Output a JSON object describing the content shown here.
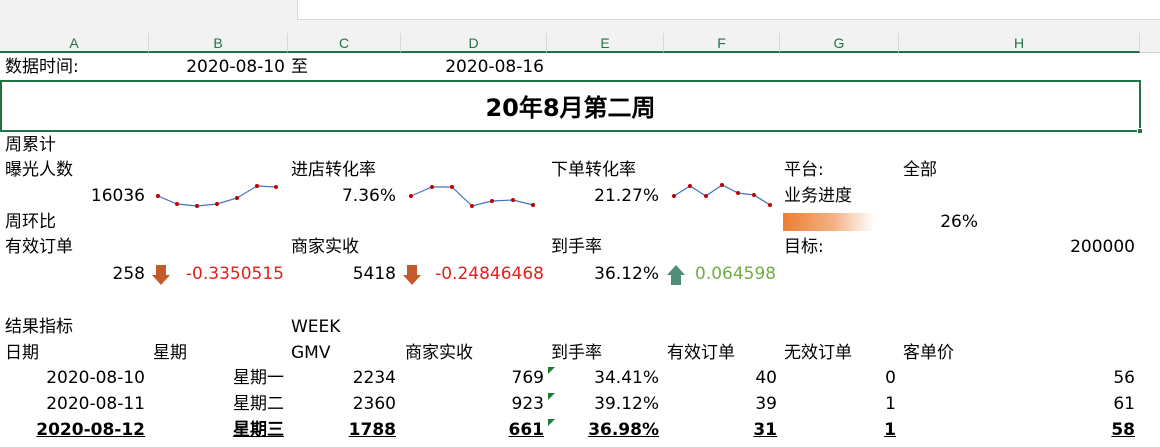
{
  "columns": [
    "A",
    "B",
    "C",
    "D",
    "E",
    "F",
    "G",
    "H"
  ],
  "header": {
    "data_time_label": "数据时间:",
    "start_date": "2020-08-10",
    "to_label": "至",
    "end_date": "2020-08-16",
    "title": "20年8月第二周"
  },
  "weekly": {
    "section_label": "周累计",
    "exposure_label": "曝光人数",
    "exposure_value": "16036",
    "store_conv_label": "进店转化率",
    "store_conv_value": "7.36%",
    "order_conv_label": "下单转化率",
    "order_conv_value": "21.27%"
  },
  "platform": {
    "label": "平台:",
    "value": "全部",
    "progress_label": "业务进度",
    "progress_value": "26%",
    "progress_fraction": 0.26,
    "target_label": "目标:",
    "target_value": "200000"
  },
  "wow": {
    "section_label": "周环比",
    "valid_orders_label": "有效订单",
    "valid_orders_value": "258",
    "valid_orders_change": "-0.3350515",
    "merchant_label": "商家实收",
    "merchant_value": "5418",
    "merchant_change": "-0.24846468",
    "arrival_label": "到手率",
    "arrival_value": "36.12%",
    "arrival_change": "0.064598"
  },
  "icons": {
    "down_arrow_color": "#c55a2b",
    "up_arrow_color": "#4e8f77"
  },
  "results": {
    "section_label": "结果指标",
    "week_label": "WEEK",
    "headers": {
      "date": "日期",
      "weekday": "星期",
      "gmv": "GMV",
      "merchant": "商家实收",
      "arrival": "到手率",
      "valid": "有效订单",
      "invalid": "无效订单",
      "avg": "客单价"
    },
    "rows": [
      {
        "date": "2020-08-10",
        "weekday": "星期一",
        "gmv": "2234",
        "merchant": "769",
        "arrival": "34.41%",
        "valid": "40",
        "invalid": "0",
        "avg": "56"
      },
      {
        "date": "2020-08-11",
        "weekday": "星期二",
        "gmv": "2360",
        "merchant": "923",
        "arrival": "39.12%",
        "valid": "39",
        "invalid": "1",
        "avg": "61"
      },
      {
        "date": "2020-08-12",
        "weekday": "星期三",
        "gmv": "1788",
        "merchant": "661",
        "arrival": "36.98%",
        "valid": "31",
        "invalid": "1",
        "avg": "58"
      }
    ]
  }
}
